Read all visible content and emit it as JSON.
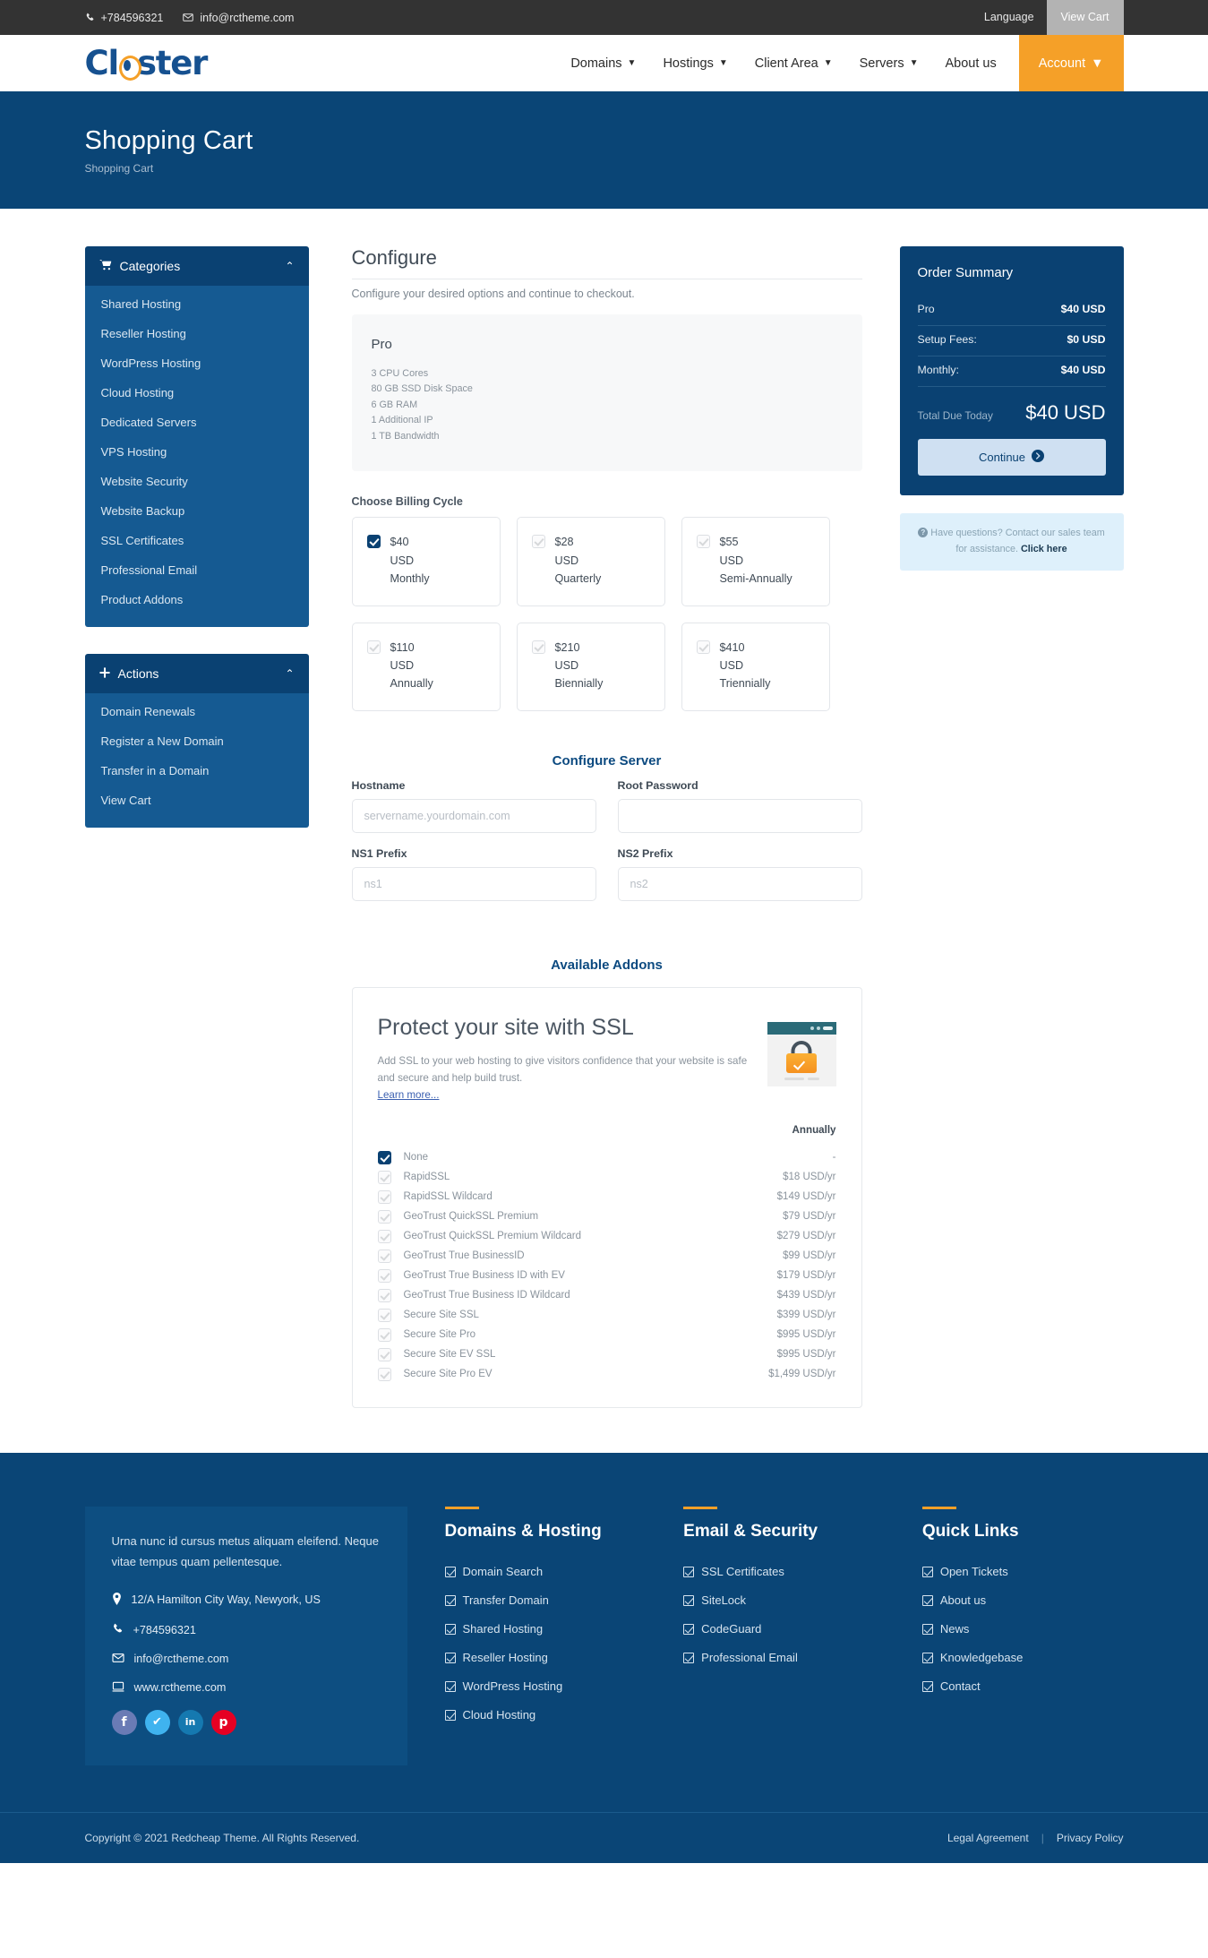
{
  "topbar": {
    "phone": "+784596321",
    "email": "info@rctheme.com",
    "language": "Language",
    "view_cart": "View Cart"
  },
  "brand": {
    "name_before": "Cl",
    "name_after": "ster"
  },
  "nav": {
    "items": [
      {
        "label": "Domains",
        "caret": true
      },
      {
        "label": "Hostings",
        "caret": true
      },
      {
        "label": "Client Area",
        "caret": true
      },
      {
        "label": "Servers",
        "caret": true
      },
      {
        "label": "About us",
        "caret": false
      }
    ],
    "account": "Account"
  },
  "pagehead": {
    "title": "Shopping Cart",
    "breadcrumb": "Shopping Cart"
  },
  "sidebar": {
    "categories": {
      "title": "Categories",
      "items": [
        "Shared Hosting",
        "Reseller Hosting",
        "WordPress Hosting",
        "Cloud Hosting",
        "Dedicated Servers",
        "VPS Hosting",
        "Website Security",
        "Website Backup",
        "SSL Certificates",
        "Professional Email",
        "Product Addons"
      ]
    },
    "actions": {
      "title": "Actions",
      "items": [
        "Domain Renewals",
        "Register a New Domain",
        "Transfer in a Domain",
        "View Cart"
      ]
    }
  },
  "configure": {
    "title": "Configure",
    "subtitle": "Configure your desired options and continue to checkout.",
    "product": {
      "name": "Pro",
      "specs": [
        "3 CPU Cores",
        "80 GB SSD Disk Space",
        "6 GB RAM",
        "1 Additional IP",
        "1 TB Bandwidth"
      ]
    },
    "billing_label": "Choose Billing Cycle",
    "cycles": [
      {
        "price": "$40",
        "currency": "USD",
        "period": "Monthly",
        "selected": true
      },
      {
        "price": "$28",
        "currency": "USD",
        "period": "Quarterly",
        "selected": false
      },
      {
        "price": "$55",
        "currency": "USD",
        "period": "Semi-Annually",
        "selected": false
      },
      {
        "price": "$110",
        "currency": "USD",
        "period": "Annually",
        "selected": false
      },
      {
        "price": "$210",
        "currency": "USD",
        "period": "Biennially",
        "selected": false
      },
      {
        "price": "$410",
        "currency": "USD",
        "period": "Triennially",
        "selected": false
      }
    ]
  },
  "server": {
    "title": "Configure Server",
    "fields": [
      {
        "label": "Hostname",
        "placeholder": "servername.yourdomain.com",
        "value": ""
      },
      {
        "label": "Root Password",
        "placeholder": "",
        "value": ""
      },
      {
        "label": "NS1 Prefix",
        "placeholder": "ns1",
        "value": ""
      },
      {
        "label": "NS2 Prefix",
        "placeholder": "ns2",
        "value": ""
      }
    ]
  },
  "addons": {
    "title": "Available Addons",
    "ssl": {
      "heading": "Protect your site with SSL",
      "description": "Add SSL to your web hosting to give visitors confidence that your website is safe and secure and help build trust.",
      "learn_more": "Learn more...",
      "period_header": "Annually",
      "options": [
        {
          "name": "None",
          "price": "-",
          "selected": true
        },
        {
          "name": "RapidSSL",
          "price": "$18 USD/yr",
          "selected": false
        },
        {
          "name": "RapidSSL Wildcard",
          "price": "$149 USD/yr",
          "selected": false
        },
        {
          "name": "GeoTrust QuickSSL Premium",
          "price": "$79 USD/yr",
          "selected": false
        },
        {
          "name": "GeoTrust QuickSSL Premium Wildcard",
          "price": "$279 USD/yr",
          "selected": false
        },
        {
          "name": "GeoTrust True BusinessID",
          "price": "$99 USD/yr",
          "selected": false
        },
        {
          "name": "GeoTrust True Business ID with EV",
          "price": "$179 USD/yr",
          "selected": false
        },
        {
          "name": "GeoTrust True Business ID Wildcard",
          "price": "$439 USD/yr",
          "selected": false
        },
        {
          "name": "Secure Site SSL",
          "price": "$399 USD/yr",
          "selected": false
        },
        {
          "name": "Secure Site Pro",
          "price": "$995 USD/yr",
          "selected": false
        },
        {
          "name": "Secure Site EV SSL",
          "price": "$995 USD/yr",
          "selected": false
        },
        {
          "name": "Secure Site Pro EV",
          "price": "$1,499 USD/yr",
          "selected": false
        }
      ]
    }
  },
  "summary": {
    "title": "Order Summary",
    "rows": [
      {
        "label": "Pro",
        "value": "$40 USD"
      },
      {
        "label": "Setup Fees:",
        "value": "$0 USD"
      },
      {
        "label": "Monthly:",
        "value": "$40 USD"
      }
    ],
    "total_label": "Total Due Today",
    "total_value": "$40 USD",
    "continue": "Continue",
    "help_text": "Have questions? Contact our sales team for assistance.",
    "help_link": "Click here"
  },
  "footer": {
    "about": {
      "text": "Urna nunc id cursus metus aliquam eleifend. Neque vitae tempus quam pellentesque.",
      "address": "12/A Hamilton City Way, Newyork, US",
      "phone": "+784596321",
      "email": "info@rctheme.com",
      "website": "www.rctheme.com",
      "socials": [
        {
          "name": "facebook-icon",
          "glyph": "f",
          "color": "#6a7bb5"
        },
        {
          "name": "twitter-icon",
          "glyph": "t",
          "color": "#3fb3ef"
        },
        {
          "name": "linkedin-icon",
          "glyph": "in",
          "color": "#1579b0"
        },
        {
          "name": "pinterest-icon",
          "glyph": "p",
          "color": "#e60023"
        }
      ]
    },
    "columns": [
      {
        "title": "Domains & Hosting",
        "links": [
          "Domain Search",
          "Transfer Domain",
          "Shared Hosting",
          "Reseller Hosting",
          "WordPress Hosting",
          "Cloud Hosting"
        ]
      },
      {
        "title": "Email & Security",
        "links": [
          "SSL Certificates",
          "SiteLock",
          "CodeGuard",
          "Professional Email"
        ]
      },
      {
        "title": "Quick Links",
        "links": [
          "Open Tickets",
          "About us",
          "News",
          "Knowledgebase",
          "Contact"
        ]
      }
    ],
    "copyright": "Copyright © 2021 Redcheap Theme. All Rights Reserved.",
    "legal": "Legal Agreement",
    "privacy": "Privacy Policy"
  },
  "colors": {
    "brand_blue": "#165190",
    "header_blue": "#0a4576",
    "panel_blue": "#0a4172",
    "accent_orange": "#f5a028"
  }
}
